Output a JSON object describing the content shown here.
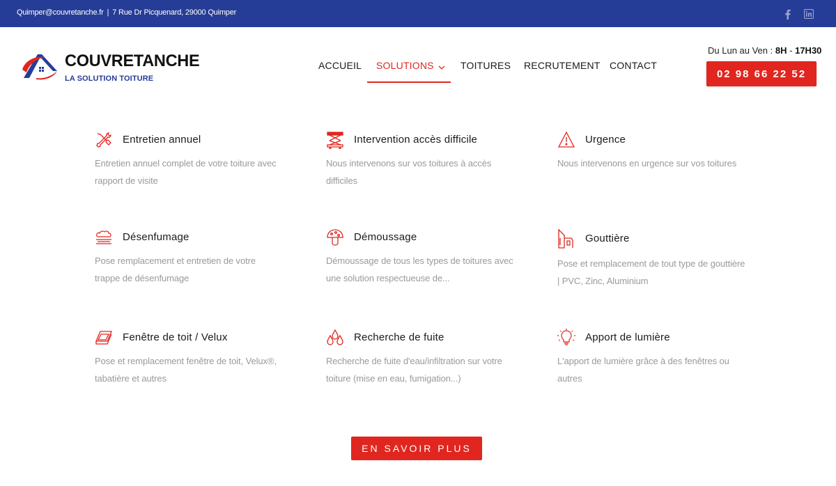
{
  "topbar": {
    "email": "Quimper@couvretanche.fr",
    "separator": "|",
    "address": "7 Rue Dr Picquenard, 29000 Quimper",
    "facebook_icon": "facebook-icon",
    "linkedin_icon": "linkedin-icon",
    "background": "#263d97"
  },
  "logo": {
    "name": "COUVRETANCHE",
    "tagline": "LA SOLUTION TOITURE"
  },
  "nav": {
    "items": [
      "ACCUEIL",
      "SOLUTIONS",
      "TOITURES",
      "RECRUTEMENT",
      "CONTACT"
    ],
    "active": "SOLUTIONS"
  },
  "contact": {
    "hours_prefix": "Du Lun au Ven :",
    "hours_start": "8H",
    "hours_dash": "-",
    "hours_end": "17H30",
    "phone": "02 98 66 22 52"
  },
  "services": [
    {
      "title": "Entretien annuel",
      "desc": "Entretien annuel complet de votre toiture avec rapport de visite",
      "icon": "tools-icon"
    },
    {
      "title": "Intervention accès difficile",
      "desc": "Nous intervenons sur vos toitures à accès difficiles",
      "icon": "scissor-lift-icon"
    },
    {
      "title": "Urgence",
      "desc": "Nous intervenons en urgence sur vos toitures",
      "icon": "warning-icon"
    },
    {
      "title": "Désenfumage",
      "desc": "Pose remplacement et entretien de votre trappe de désenfumage",
      "icon": "smoke-icon"
    },
    {
      "title": "Démoussage",
      "desc": "Démoussage de tous les types de toitures avec une solution respectueuse de...",
      "icon": "mushroom-icon"
    },
    {
      "title": "Gouttière",
      "desc": "Pose et remplacement de tout type de gouttière | PVC, Zinc, Aluminium",
      "icon": "gutter-icon"
    },
    {
      "title": "Fenêtre de toit / Velux",
      "desc": "Pose et remplacement fenêtre de toit, Velux®, tabatière et autres",
      "icon": "roof-window-icon"
    },
    {
      "title": "Recherche de fuite",
      "desc": "Recherche de fuite d'eau/infiltration sur votre toiture (mise en eau, fumigation...)",
      "icon": "water-drops-icon"
    },
    {
      "title": "Apport de lumière",
      "desc": "L'apport de lumière grâce à des fenêtres ou autres",
      "icon": "light-bulb-icon"
    }
  ],
  "cta_label": "EN SAVOIR PLUS",
  "colors": {
    "accent": "#e0261f",
    "brand_blue": "#263d97",
    "desc_text": "#9a9a9a"
  }
}
